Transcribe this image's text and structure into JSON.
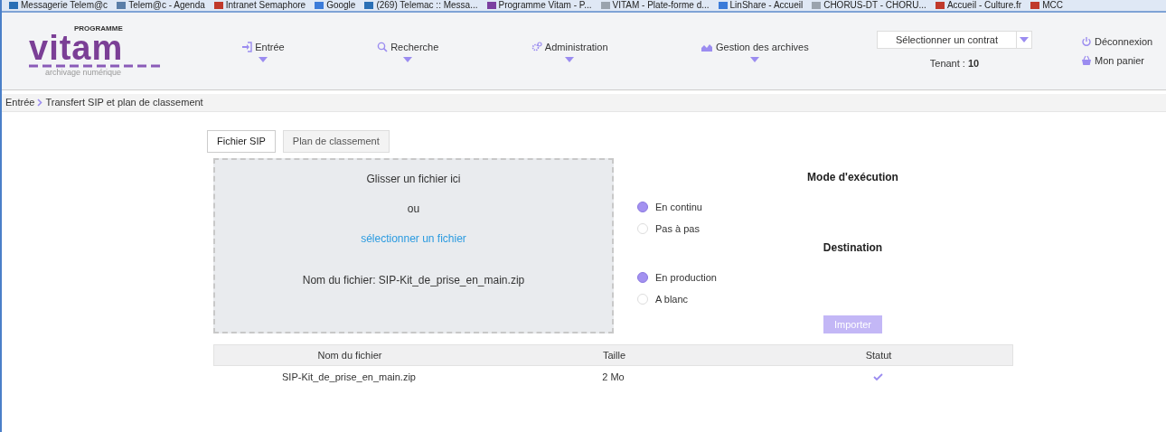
{
  "bookmarks": [
    {
      "label": "Messagerie Telem@c",
      "color": "#2a6fb5"
    },
    {
      "label": "Telem@c - Agenda",
      "color": "#5a7ea8"
    },
    {
      "label": "Intranet Semaphore",
      "color": "#c0392b"
    },
    {
      "label": "Google",
      "color": "#3b7bd9"
    },
    {
      "label": "(269) Telemac :: Messa...",
      "color": "#2a6fb5"
    },
    {
      "label": "Programme Vitam - P...",
      "color": "#7b3fa0"
    },
    {
      "label": "VITAM - Plate-forme d...",
      "color": "#9aa3ad"
    },
    {
      "label": "LinShare - Accueil",
      "color": "#3b7bd9"
    },
    {
      "label": "CHORUS-DT - CHORU...",
      "color": "#9aa3ad"
    },
    {
      "label": "Accueil - Culture.fr",
      "color": "#c0392b"
    },
    {
      "label": "MCC",
      "color": "#c0392b"
    }
  ],
  "logo": {
    "program": "PROGRAMME",
    "name": "vitam",
    "tagline": "archivage numérique"
  },
  "nav": [
    {
      "label": "Entrée"
    },
    {
      "label": "Recherche"
    },
    {
      "label": "Administration"
    },
    {
      "label": "Gestion des archives"
    }
  ],
  "contract": {
    "placeholder": "Sélectionner un contrat",
    "tenant_label": "Tenant :",
    "tenant": "10"
  },
  "user_links": [
    {
      "label": "Déconnexion"
    },
    {
      "label": "Mon panier"
    }
  ],
  "breadcrumb": [
    "Entrée",
    "Transfert SIP et plan de classement"
  ],
  "tabs": [
    {
      "label": "Fichier SIP",
      "selected": true
    },
    {
      "label": "Plan de classement",
      "selected": false
    }
  ],
  "dropzone": {
    "title": "Glisser un fichier ici",
    "or": "ou",
    "link": "sélectionner un fichier",
    "filename": "Nom du fichier: SIP-Kit_de_prise_en_main.zip"
  },
  "options": [
    {
      "title": "Mode d'exécution",
      "choices": [
        {
          "label": "En continu",
          "selected": true
        },
        {
          "label": "Pas à pas",
          "selected": false
        }
      ]
    },
    {
      "title": "Destination",
      "choices": [
        {
          "label": "En production",
          "selected": true
        },
        {
          "label": "A blanc",
          "selected": false
        }
      ]
    }
  ],
  "import_button": {
    "label": "Importer",
    "disabled": true
  },
  "table": {
    "columns": [
      "Nom du fichier",
      "Taille",
      "Statut"
    ],
    "rows": [
      {
        "name": "SIP-Kit_de_prise_en_main.zip",
        "size": "2 Mo",
        "done": true
      }
    ]
  }
}
